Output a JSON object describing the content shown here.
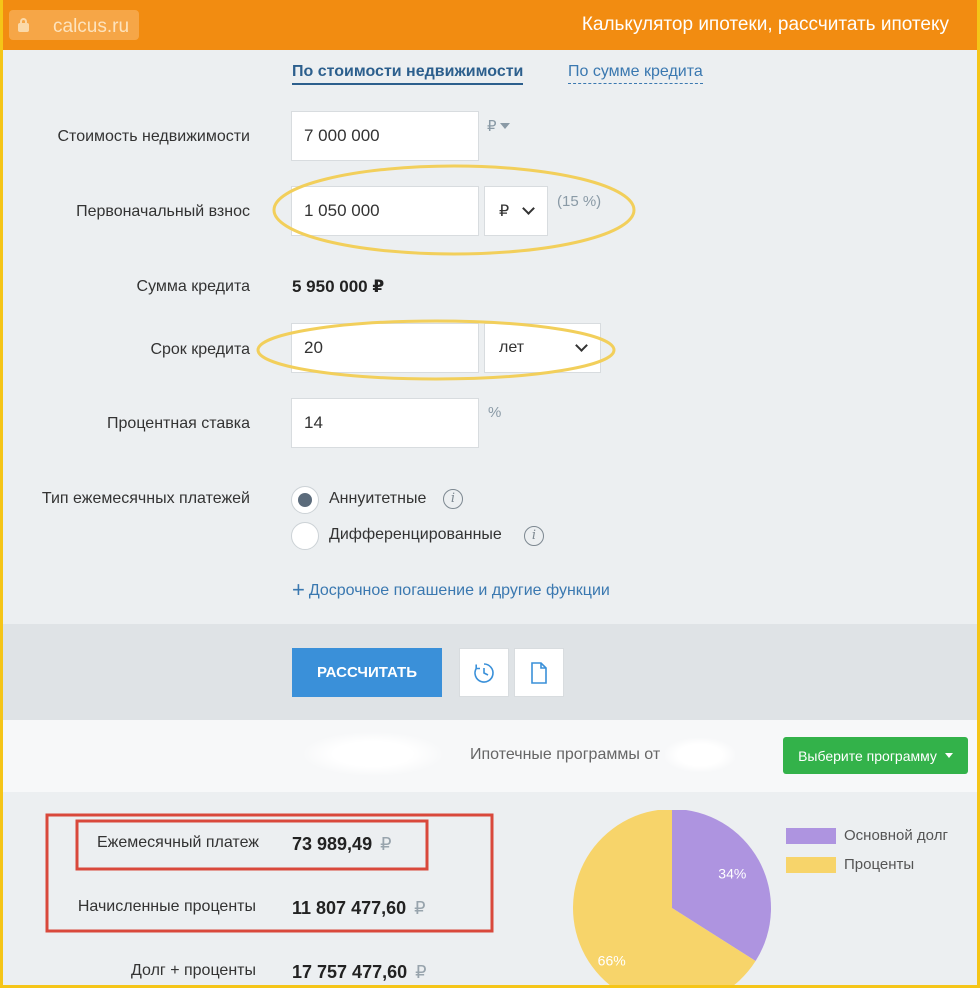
{
  "browser": {
    "domain": "calcus.ru"
  },
  "header": {
    "title": "Калькулятор ипотеки, рассчитать ипотеку"
  },
  "tabs": [
    {
      "label": "По стоимости недвижимости",
      "active": true
    },
    {
      "label": "По сумме кредита",
      "active": false
    }
  ],
  "form": {
    "property_cost": {
      "label": "Стоимость недвижимости",
      "value": "7 000 000",
      "currency": "₽"
    },
    "down_payment": {
      "label": "Первоначальный взнос",
      "value": "1 050 000",
      "unit": "₽",
      "percent_hint": "(15 %)"
    },
    "loan_amount": {
      "label": "Сумма кредита",
      "value": "5 950 000 ₽"
    },
    "term": {
      "label": "Срок кредита",
      "value": "20",
      "unit": "лет"
    },
    "rate": {
      "label": "Процентная ставка",
      "value": "14",
      "unit": "%"
    },
    "payment_type": {
      "label": "Тип ежемесячных платежей",
      "options": [
        {
          "label": "Аннуитетные",
          "selected": true
        },
        {
          "label": "Дифференцированные",
          "selected": false
        }
      ]
    },
    "more_link": "Досрочное погашение и другие функции"
  },
  "actions": {
    "calculate": "РАССЧИТАТЬ",
    "history_icon": "clock-icon",
    "document_icon": "document-icon"
  },
  "programs": {
    "text": "Ипотечные программы от",
    "button": "Выберите программу"
  },
  "results": {
    "monthly_payment": {
      "label": "Ежемесячный платеж",
      "value": "73 989,49",
      "currency": "₽"
    },
    "accrued_interest": {
      "label": "Начисленные проценты",
      "value": "11 807 477,60",
      "currency": "₽"
    },
    "debt_plus_interest": {
      "label": "Долг + проценты",
      "value": "17 757 477,60",
      "currency": "₽"
    }
  },
  "chart_data": {
    "type": "pie",
    "categories": [
      "Основной долг",
      "Проценты"
    ],
    "values": [
      34,
      66
    ],
    "labels": [
      "34%",
      "66%"
    ],
    "colors": [
      "#ae94e0",
      "#f7d46a"
    ],
    "legend": "right"
  },
  "colors": {
    "topbar": "#f28c11",
    "primary_button": "#3a90d9",
    "program_button": "#33b24a",
    "highlight_ellipse": "#f2cf5b",
    "highlight_box": "#d9483b"
  }
}
